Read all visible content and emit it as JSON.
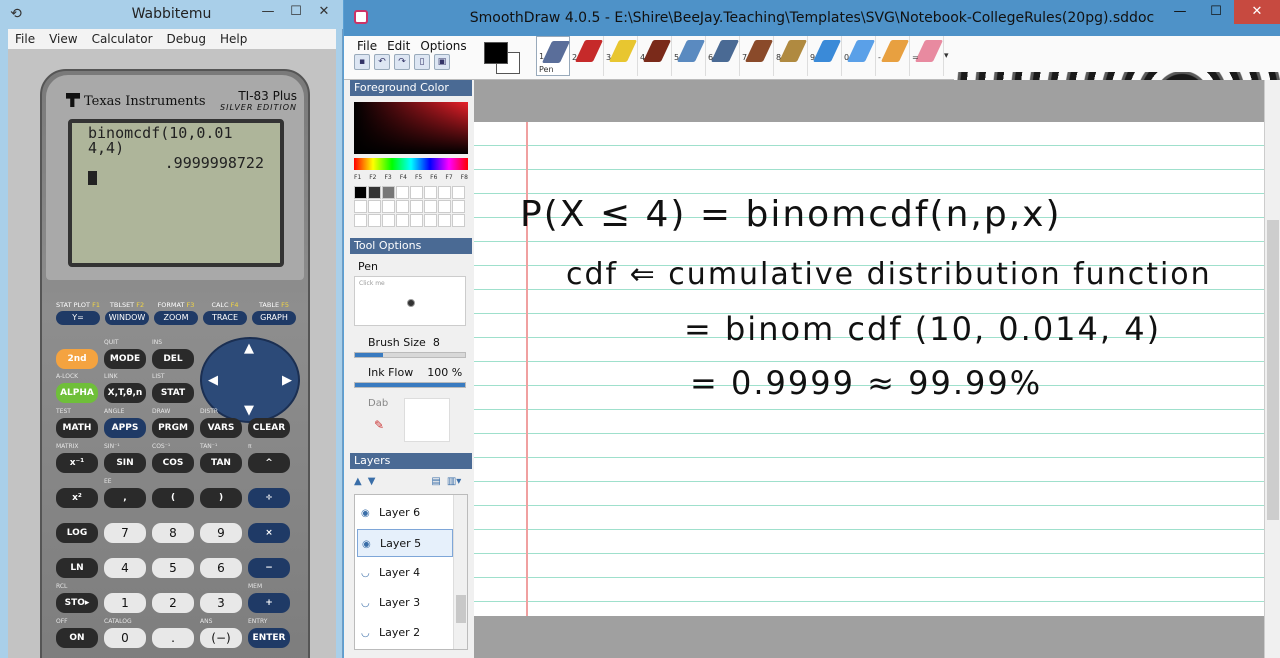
{
  "wabbitemu": {
    "title": "Wabbitemu",
    "menu": [
      "File",
      "View",
      "Calculator",
      "Debug",
      "Help"
    ],
    "brand": "Texas Instruments",
    "model": "TI-83 Plus",
    "edition": "SILVER EDITION",
    "screen": {
      "line1": "binomcdf(10,0.01",
      "line2": "4,4)",
      "result": ".9999998722"
    },
    "fkeys": [
      {
        "top": "STAT PLOT",
        "f": "F1",
        "key": "Y="
      },
      {
        "top": "TBLSET",
        "f": "F2",
        "key": "WINDOW"
      },
      {
        "top": "FORMAT",
        "f": "F3",
        "key": "ZOOM"
      },
      {
        "top": "CALC",
        "f": "F4",
        "key": "TRACE"
      },
      {
        "top": "TABLE",
        "f": "F5",
        "key": "GRAPH"
      }
    ],
    "keys": {
      "second": "2nd",
      "mode": "MODE",
      "del": "DEL",
      "alpha": "ALPHA",
      "xton": "X,T,θ,n",
      "stat": "STAT",
      "math": "MATH",
      "apps": "APPS",
      "prgm": "PRGM",
      "vars": "VARS",
      "clear": "CLEAR",
      "inv": "x⁻¹",
      "sin": "SIN",
      "cos": "COS",
      "tan": "TAN",
      "pow": "^",
      "sq": "x²",
      "comma": ",",
      "lp": "(",
      "rp": ")",
      "div": "÷",
      "log": "LOG",
      "k7": "7",
      "k8": "8",
      "k9": "9",
      "mul": "×",
      "ln": "LN",
      "k4": "4",
      "k5": "5",
      "k6": "6",
      "minus": "−",
      "sto": "STO▸",
      "k1": "1",
      "k2": "2",
      "k3": "3",
      "plus": "+",
      "on": "ON",
      "k0": "0",
      "dot": ".",
      "neg": "(−)",
      "enter": "ENTER"
    },
    "sublabels": {
      "quit": "QUIT",
      "ins": "INS",
      "alock": "A-LOCK",
      "link": "LINK",
      "list": "LIST",
      "test": "TEST",
      "angle": "ANGLE",
      "draw": "DRAW",
      "distr": "DISTR",
      "matrix": "MATRIX",
      "sinv": "SIN⁻¹",
      "cosv": "COS⁻¹",
      "tanv": "TAN⁻¹",
      "pi": "π",
      "ee": "EE",
      "rcl": "RCL",
      "mem": "MEM",
      "off": "OFF",
      "catalog": "CATALOG",
      "ans": "ANS",
      "entry": "ENTRY",
      "solve": "SOLVE"
    }
  },
  "smoothdraw": {
    "title": "SmoothDraw 4.0.5 - E:\\Shire\\BeeJay.Teaching\\Templates\\SVG\\Notebook-CollegeRules(20pg).sddoc",
    "menu": [
      "File",
      "Edit",
      "Options"
    ],
    "tools": [
      {
        "num": "1",
        "name": "Pen",
        "color": "#5a6e9a",
        "selected": true
      },
      {
        "num": "2",
        "name": "",
        "color": "#c62a2a"
      },
      {
        "num": "3",
        "name": "",
        "color": "#e8c630"
      },
      {
        "num": "4",
        "name": "",
        "color": "#7a2a1a"
      },
      {
        "num": "5",
        "name": "",
        "color": "#5a8ac0"
      },
      {
        "num": "6",
        "name": "",
        "color": "#4a6a94"
      },
      {
        "num": "7",
        "name": "",
        "color": "#8a4a2a"
      },
      {
        "num": "8",
        "name": "",
        "color": "#b08a40"
      },
      {
        "num": "9",
        "name": "",
        "color": "#3a8ad8"
      },
      {
        "num": "0",
        "name": "",
        "color": "#5aa0e8"
      },
      {
        "num": "-",
        "name": "",
        "color": "#e8a040"
      },
      {
        "num": "=",
        "name": "",
        "color": "#e88aa0"
      }
    ],
    "foreground_header": "Foreground Color",
    "fkey_labels": [
      "F1",
      "F2",
      "F3",
      "F4",
      "F5",
      "F6",
      "F7",
      "F8"
    ],
    "tool_options_header": "Tool Options",
    "pen_name": "Pen",
    "preview_hint": "Click me",
    "brush_size_label": "Brush Size",
    "brush_size": "8",
    "brush_size_fraction": 0.25,
    "ink_flow_label": "Ink Flow",
    "ink_flow": "100 %",
    "ink_flow_fraction": 1.0,
    "dab_label": "Dab",
    "layers_header": "Layers",
    "layers": [
      "Layer 6",
      "Layer 5",
      "Layer 4",
      "Layer 3",
      "Layer 2"
    ],
    "selected_layer": "Layer 5",
    "handwriting": [
      "P(X ≤ 4) = binomcdf(n,p,x)",
      "cdf ⇐ cumulative   distribution   function",
      "= binom cdf (10, 0.014, 4)",
      "= 0.9999   ≈ 99.99%"
    ]
  }
}
